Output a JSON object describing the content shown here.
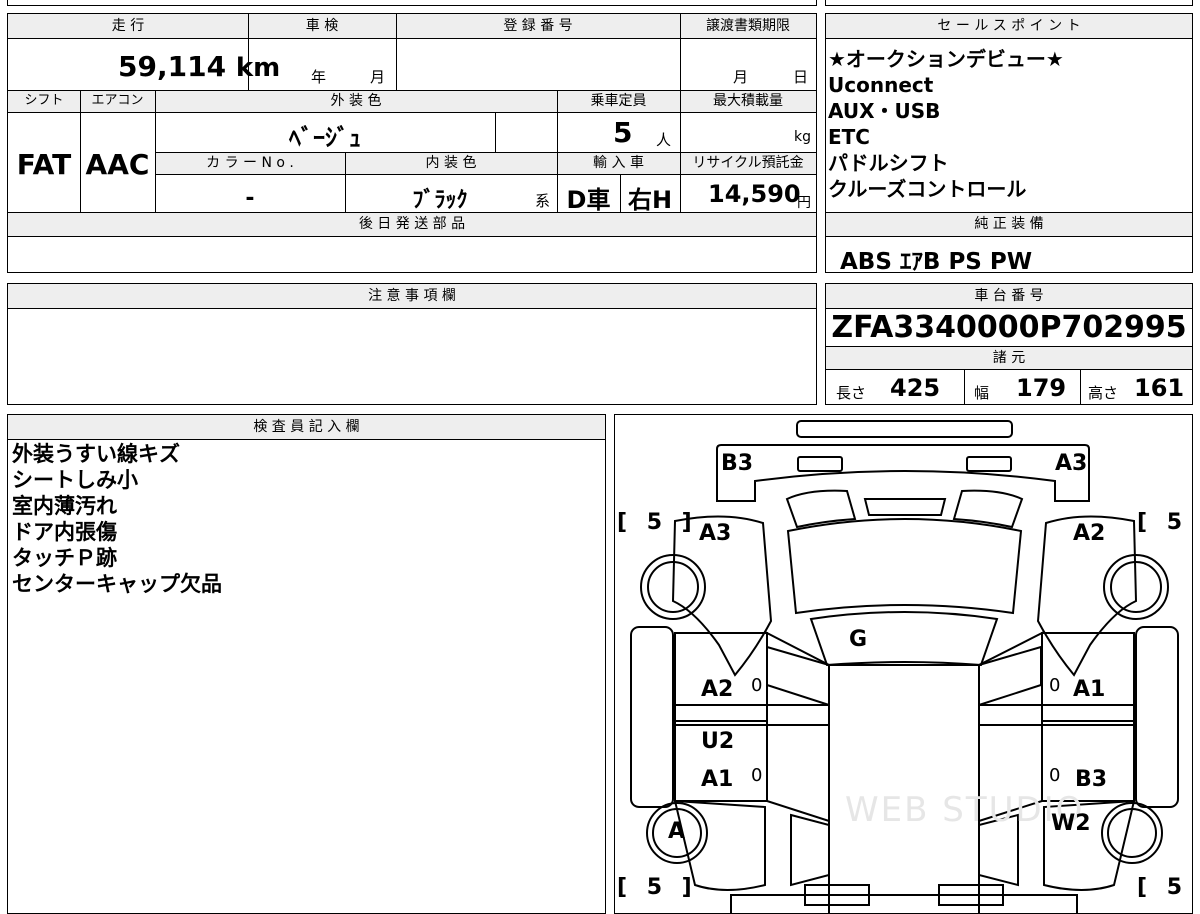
{
  "mileage": {
    "label": "走 行",
    "value": "59,114",
    "unit": "km"
  },
  "inspection": {
    "label": "車 検",
    "year_label": "年",
    "month_label": "月"
  },
  "registration": {
    "label": "登 録 番 号",
    "value": ""
  },
  "transfer_deadline": {
    "label": "譲渡書類期限",
    "month_label": "月",
    "day_label": "日"
  },
  "shift": {
    "label": "シフト",
    "value": "FAT"
  },
  "aircon": {
    "label": "エアコン",
    "value": "AAC"
  },
  "exterior_color": {
    "label": "外 装 色",
    "value": "ﾍﾞｰｼﾞｭ"
  },
  "capacity": {
    "label": "乗車定員",
    "value": "5",
    "unit": "人"
  },
  "max_load": {
    "label": "最大積載量",
    "unit": "kg"
  },
  "color_no": {
    "label": "カ ラ ー N o .",
    "value": "-"
  },
  "interior_color": {
    "label": "内 装 色",
    "value": "ﾌﾞﾗｯｸ",
    "suffix": "系"
  },
  "import": {
    "label": "輸 入 車",
    "value1": "D車",
    "value2": "右H"
  },
  "recycle": {
    "label": "リサイクル預託金",
    "value": "14,590",
    "unit": "円"
  },
  "later_parts": {
    "label": "後 日 発 送 部 品"
  },
  "notes": {
    "label": "注 意 事 項 欄"
  },
  "sales_points": {
    "label": "セ ー ル ス ポ イ ン ト",
    "items": [
      "★オークションデビュー★",
      "Uconnect",
      "AUX・USB",
      "ETC",
      "パドルシフト",
      "クルーズコントロール"
    ]
  },
  "equipment": {
    "label": "純 正 装 備",
    "value": "ABS ｴｱB PS PW"
  },
  "chassis": {
    "label": "車 台 番 号",
    "value": "ZFA3340000P702995"
  },
  "specs": {
    "label": "諸 元",
    "length_label": "長さ",
    "length": "425",
    "width_label": "幅",
    "width": "179",
    "height_label": "高さ",
    "height": "161"
  },
  "inspector": {
    "label": "検 査 員 記 入 欄",
    "lines": [
      "外装うすい線キズ",
      "シートしみ小",
      "室内薄汚れ",
      "ドア内張傷",
      "タッチＰ跡",
      "センターキャップ欠品"
    ]
  },
  "diagram": {
    "b3_top": "B3",
    "a3_top": "A3",
    "a3_left": "A3",
    "a2_right": "A2",
    "g": "G",
    "a2_left": "A2",
    "a1_right": "A1",
    "u2": "U2",
    "a1_left": "A1",
    "b3_right": "B3",
    "a_wheel": "A",
    "w2": "W2",
    "zero1": "0",
    "zero2": "0",
    "zero3": "0",
    "zero4": "0",
    "tire_tl": "[ 5 ]",
    "tire_tr": "[ 5 ]",
    "tire_bl": "[ 5 ]",
    "tire_br": "[ 5 ]",
    "watermark": "WEB STUDIO"
  }
}
